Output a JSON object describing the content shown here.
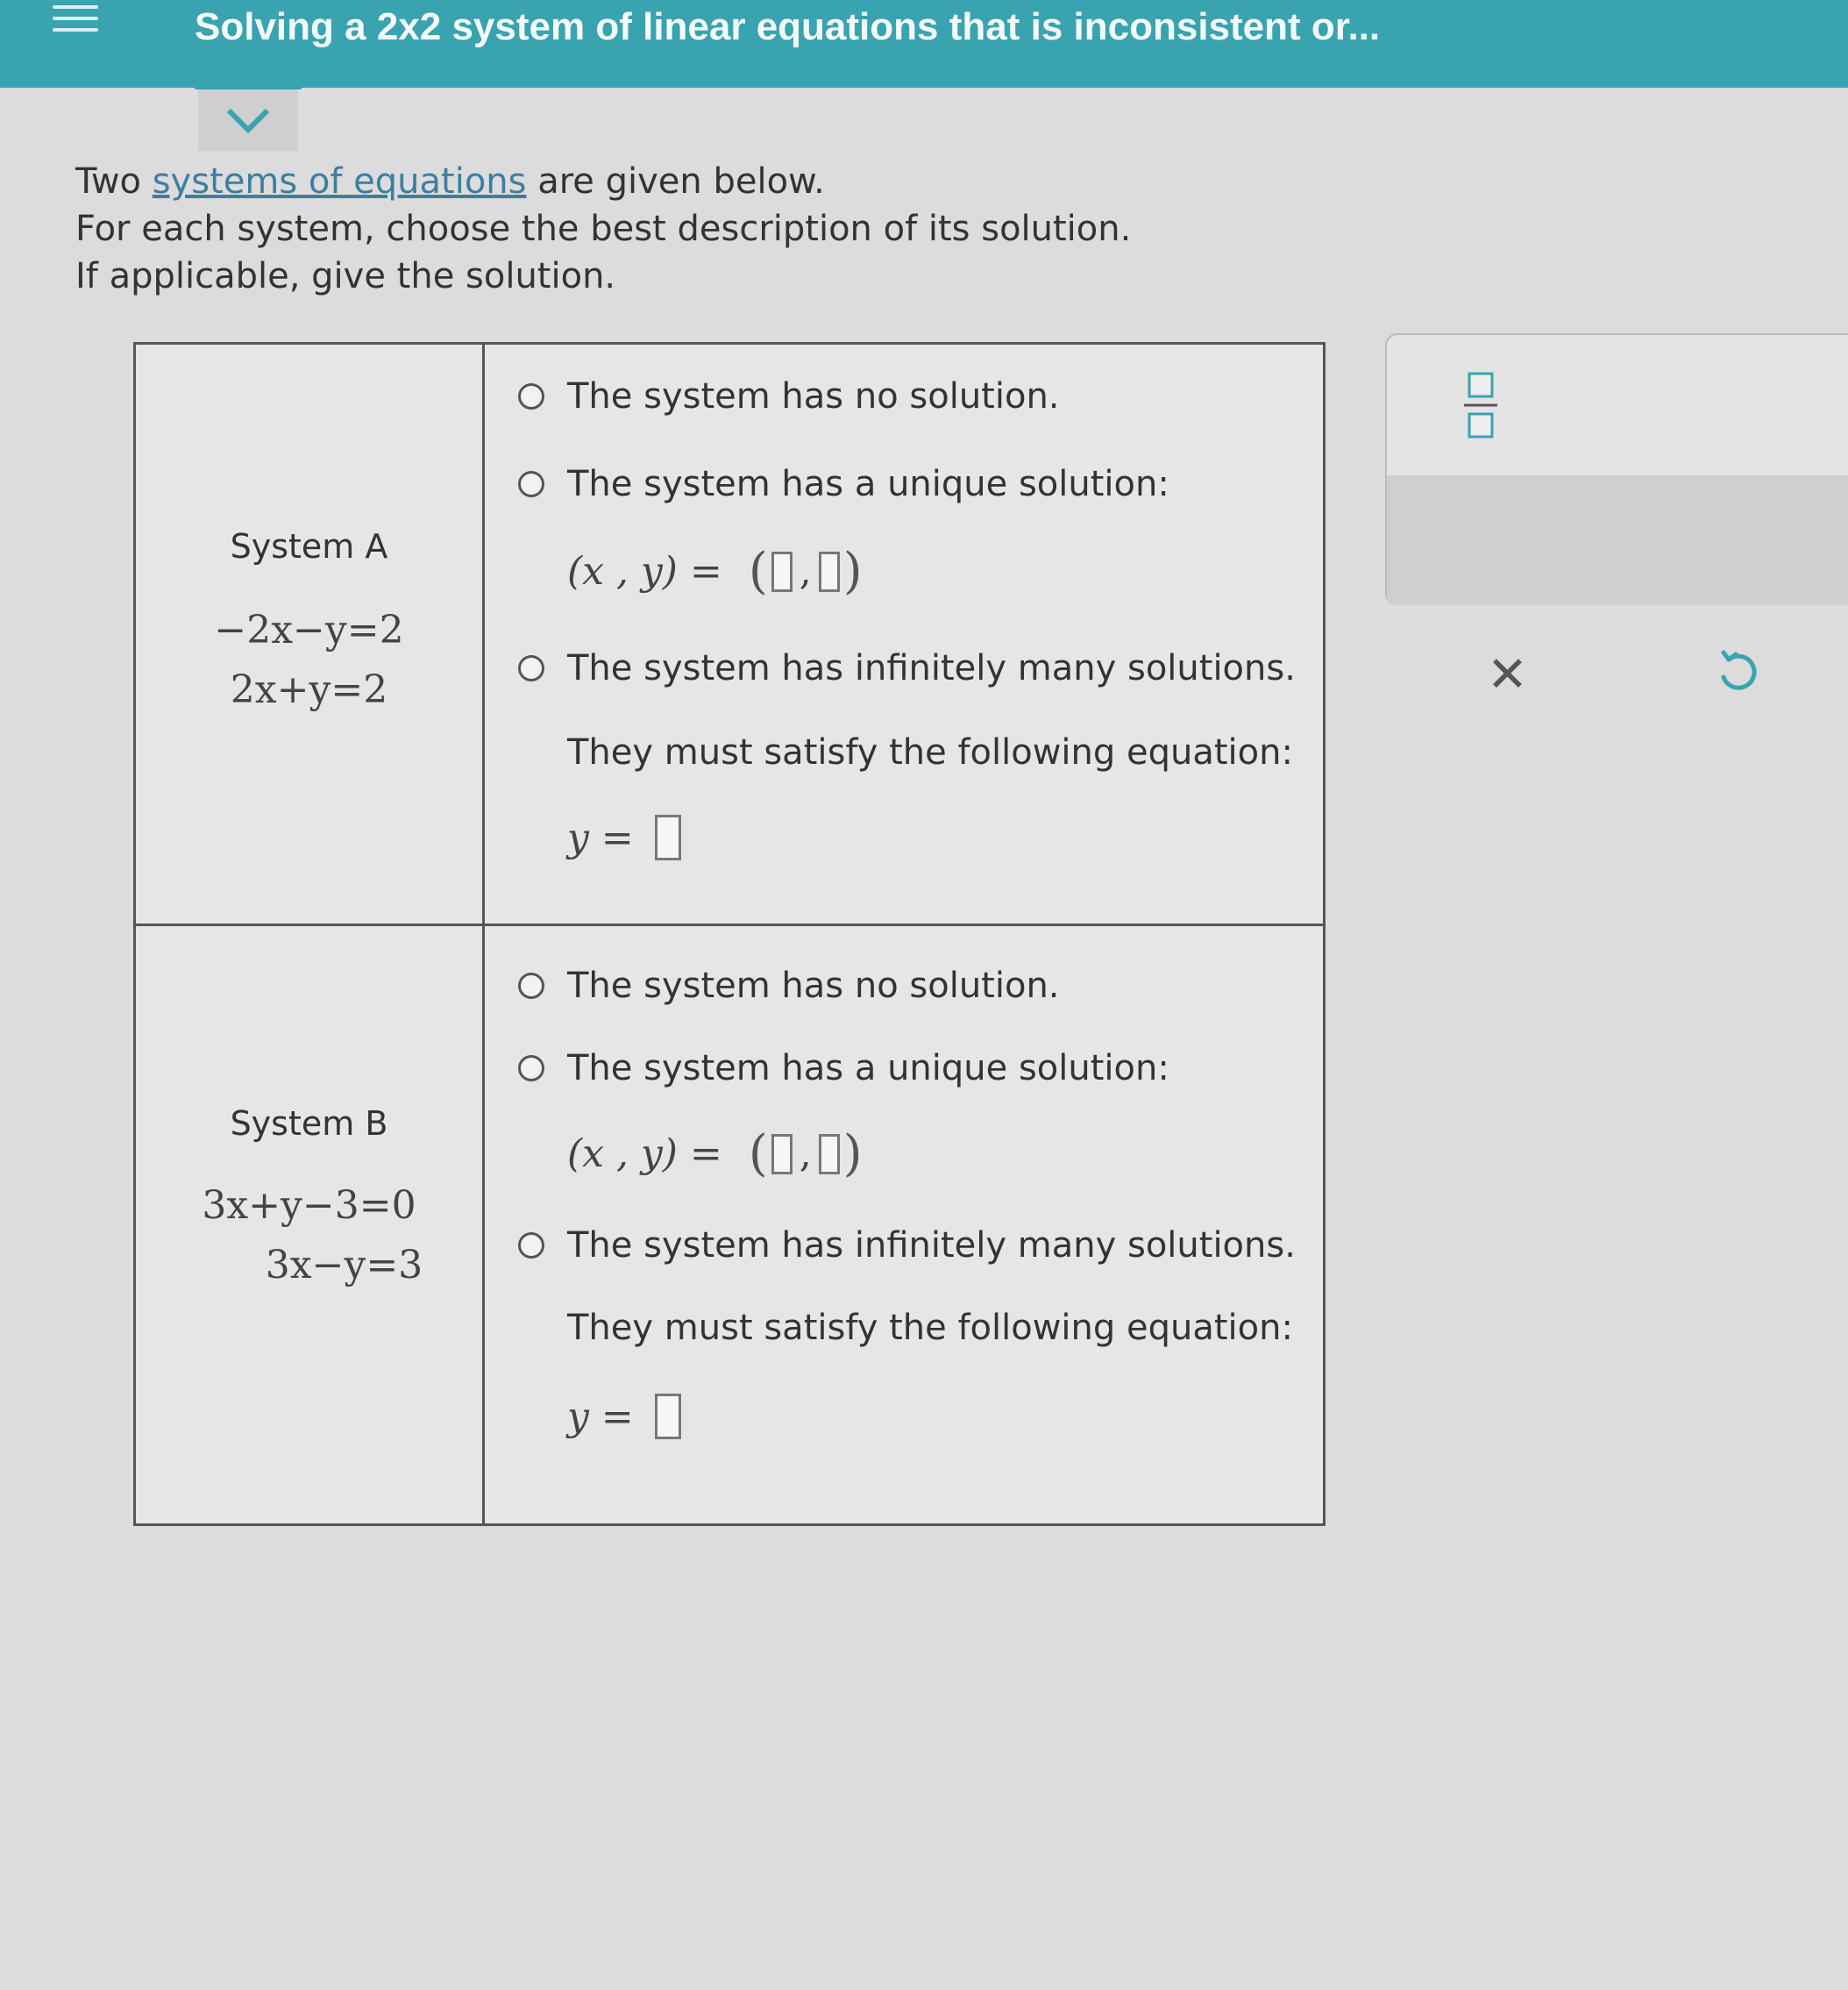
{
  "header": {
    "title": "Solving a 2x2 system of linear equations that is inconsistent or..."
  },
  "intro": {
    "line1_prefix": "Two ",
    "line1_link": "systems of equations",
    "line1_suffix": " are given below.",
    "line2": "For each system, choose the best description of its solution.",
    "line3": "If applicable, give the solution."
  },
  "systems": [
    {
      "label": "System A",
      "eq1": "−2x−y=2",
      "eq2": "2x+y=2",
      "opt_none": "The system has no solution.",
      "opt_unique": "The system has a unique solution:",
      "pair_prefix": "(x , y) =",
      "opt_infinite": "The system has infinitely many solutions.",
      "satisfy": "They must satisfy the following equation:",
      "y_prefix": "y ="
    },
    {
      "label": "System B",
      "eq1": "3x+y−3=0",
      "eq2": "3x−y=3",
      "opt_none": "The system has no solution.",
      "opt_unique": "The system has a unique solution:",
      "pair_prefix": "(x , y) =",
      "opt_infinite": "The system has infinitely many solutions.",
      "satisfy": "They must satisfy the following equation:",
      "y_prefix": "y ="
    }
  ],
  "toolbar": {
    "icons": [
      "fraction-icon",
      "clear-icon",
      "undo-icon"
    ]
  }
}
